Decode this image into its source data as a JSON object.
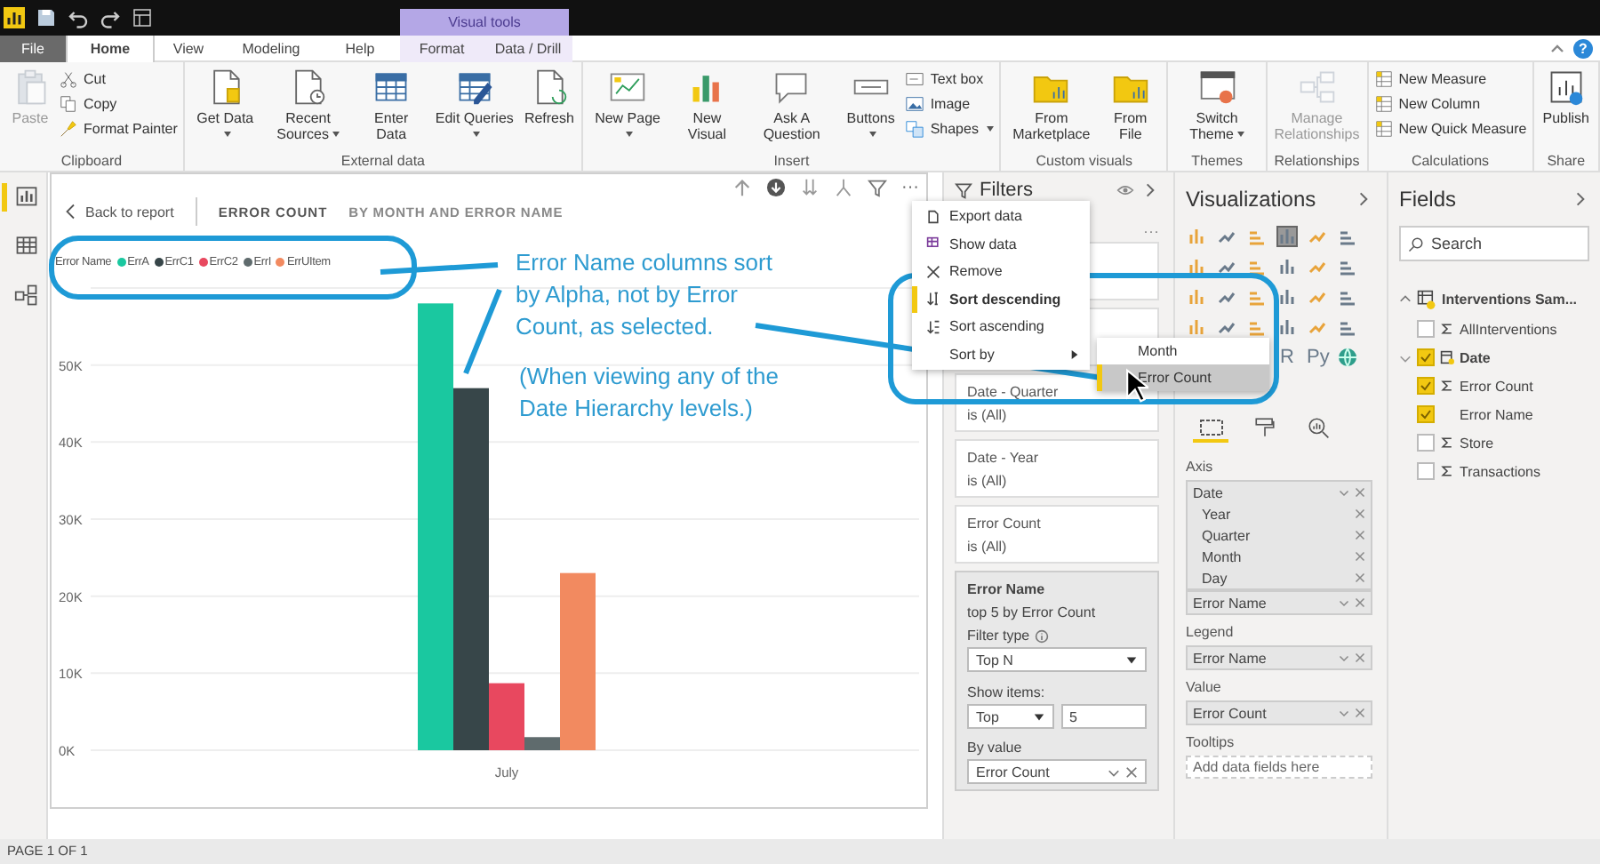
{
  "title_bar": {
    "context_label": "Visual tools"
  },
  "ribbon_tabs": [
    {
      "label": "File",
      "kind": "file",
      "selected": false
    },
    {
      "label": "Home",
      "kind": "normal",
      "selected": true
    },
    {
      "label": "View",
      "kind": "normal",
      "selected": false
    },
    {
      "label": "Modeling",
      "kind": "normal",
      "selected": false
    },
    {
      "label": "Help",
      "kind": "normal",
      "selected": false
    },
    {
      "label": "Format",
      "kind": "context",
      "selected": false
    },
    {
      "label": "Data / Drill",
      "kind": "context",
      "selected": false
    }
  ],
  "help": "?",
  "ribbon_groups": [
    {
      "label": "Clipboard",
      "items": [
        {
          "kind": "large",
          "label": "Paste",
          "disabled": true,
          "dropdown": false
        },
        {
          "kind": "stack",
          "items": [
            {
              "label": "Cut",
              "dropdown": false
            },
            {
              "label": "Copy",
              "dropdown": false
            },
            {
              "label": "Format Painter",
              "dropdown": false
            }
          ]
        }
      ]
    },
    {
      "label": "External data",
      "items": [
        {
          "kind": "large",
          "label": "Get Data",
          "disabled": false,
          "dropdown": true
        },
        {
          "kind": "large",
          "label": "Recent Sources",
          "disabled": false,
          "dropdown": true
        },
        {
          "kind": "large",
          "label": "Enter Data",
          "disabled": false,
          "dropdown": false
        },
        {
          "kind": "large",
          "label": "Edit Queries",
          "disabled": false,
          "dropdown": true
        },
        {
          "kind": "large",
          "label": "Refresh",
          "disabled": false,
          "dropdown": false
        }
      ]
    },
    {
      "label": "Insert",
      "items": [
        {
          "kind": "large",
          "label": "New Page",
          "disabled": false,
          "dropdown": true
        },
        {
          "kind": "large",
          "label": "New Visual",
          "disabled": false,
          "dropdown": false
        },
        {
          "kind": "large",
          "label": "Ask A Question",
          "disabled": false,
          "dropdown": false
        },
        {
          "kind": "large",
          "label": "Buttons",
          "disabled": false,
          "dropdown": true
        },
        {
          "kind": "stack",
          "items": [
            {
              "label": "Text box",
              "dropdown": false
            },
            {
              "label": "Image",
              "dropdown": false
            },
            {
              "label": "Shapes",
              "dropdown": true
            }
          ]
        }
      ]
    },
    {
      "label": "Custom visuals",
      "items": [
        {
          "kind": "large",
          "label": "From Marketplace",
          "disabled": false,
          "dropdown": false
        },
        {
          "kind": "large",
          "label": "From File",
          "disabled": false,
          "dropdown": false
        }
      ]
    },
    {
      "label": "Themes",
      "items": [
        {
          "kind": "large",
          "label": "Switch Theme",
          "disabled": false,
          "dropdown": true
        }
      ]
    },
    {
      "label": "Relationships",
      "items": [
        {
          "kind": "large",
          "label": "Manage Relationships",
          "disabled": true,
          "dropdown": false
        }
      ]
    },
    {
      "label": "Calculations",
      "items": [
        {
          "kind": "stack",
          "items": [
            {
              "label": "New Measure",
              "dropdown": false
            },
            {
              "label": "New Column",
              "dropdown": false
            },
            {
              "label": "New Quick Measure",
              "dropdown": false
            }
          ]
        }
      ]
    },
    {
      "label": "Share",
      "items": [
        {
          "kind": "large",
          "label": "Publish",
          "disabled": false,
          "dropdown": false
        }
      ]
    }
  ],
  "views": [
    {
      "kind": "report",
      "selected": true
    },
    {
      "kind": "data",
      "selected": false
    },
    {
      "kind": "model",
      "selected": false
    }
  ],
  "visual": {
    "more": "···",
    "back": "Back to report",
    "title": "ERROR COUNT",
    "subtitle": "BY MONTH AND ERROR NAME",
    "legend": {
      "title": "Error Name"
    },
    "chart_data": {
      "type": "bar",
      "grid": true,
      "categories": [
        "July"
      ],
      "series": [
        {
          "name": "ErrA",
          "color": "#1ac8a0",
          "values": [
            58000
          ]
        },
        {
          "name": "ErrC1",
          "color": "#374649",
          "values": [
            47000
          ]
        },
        {
          "name": "ErrC2",
          "color": "#e8485f",
          "values": [
            8700
          ]
        },
        {
          "name": "ErrI",
          "color": "#5f6b6d",
          "values": [
            1700
          ]
        },
        {
          "name": "ErrUItem",
          "color": "#f28a60",
          "values": [
            23000
          ]
        }
      ],
      "ylim": [
        0,
        60000
      ],
      "yticks": [
        {
          "value": 0,
          "label": "0K"
        },
        {
          "value": 10000,
          "label": "10K"
        },
        {
          "value": 20000,
          "label": "20K"
        },
        {
          "value": 30000,
          "label": "30K"
        },
        {
          "value": 40000,
          "label": "40K"
        },
        {
          "value": 50000,
          "label": "50K"
        }
      ]
    }
  },
  "annotation": {
    "text": "Error Name columns sort by Alpha, not by Error Count, as selected.",
    "note": "(When viewing any of the Date Hierarchy levels.)"
  },
  "context_menu": {
    "items": [
      {
        "label": "Export data",
        "kind": "export",
        "selected": false
      },
      {
        "label": "Show data",
        "kind": "show",
        "selected": false
      },
      {
        "label": "Remove",
        "kind": "remove",
        "selected": false
      },
      {
        "label": "Sort descending",
        "kind": "sort-desc",
        "selected": true
      },
      {
        "label": "Sort ascending",
        "kind": "sort-asc",
        "selected": false
      },
      {
        "label": "Sort by",
        "kind": "submenu",
        "selected": false
      }
    ],
    "submenu": [
      {
        "label": "Month",
        "selected": false
      },
      {
        "label": "Error Count",
        "selected": true
      }
    ]
  },
  "filters": {
    "title": "Filters",
    "more": "···",
    "cards": [
      {
        "field": "Date - Quarter",
        "state": "is (All)"
      },
      {
        "field": "Date - Year",
        "state": "is (All)"
      },
      {
        "field": "Error Count",
        "state": "is (All)"
      }
    ],
    "active_card": {
      "field": "Error Name",
      "summary": "top 5 by Error Count",
      "filter_type_label": "Filter type",
      "filter_type": "Top N",
      "show_items_label": "Show items:",
      "show_direction": "Top",
      "show_count": "5",
      "by_value_label": "By value",
      "by_value": "Error Count"
    }
  },
  "visualizations": {
    "title": "Visualizations",
    "script_visuals": [
      "R",
      "Py"
    ],
    "pane_tabs": [
      {
        "kind": "fields",
        "selected": true
      },
      {
        "kind": "format",
        "selected": false
      },
      {
        "kind": "analytics",
        "selected": false
      }
    ],
    "wells": [
      {
        "label": "Axis",
        "fields": [
          {
            "label": "Date",
            "children": [
              "Year",
              "Quarter",
              "Month",
              "Day"
            ]
          },
          {
            "label": "Error Name"
          }
        ]
      },
      {
        "label": "Legend",
        "fields": [
          {
            "label": "Error Name"
          }
        ]
      },
      {
        "label": "Value",
        "fields": [
          {
            "label": "Error Count"
          }
        ]
      },
      {
        "label": "Tooltips",
        "placeholder": "Add data fields here"
      }
    ]
  },
  "fields": {
    "title": "Fields",
    "search_placeholder": "Search",
    "tables": [
      {
        "label": "Interventions Sam...",
        "expanded": true,
        "children": [
          {
            "label": "AllInterventions",
            "kind": "measure",
            "checked": false
          },
          {
            "label": "Date",
            "kind": "hierarchy",
            "checked": true,
            "expanded": false
          },
          {
            "label": "Error Count",
            "kind": "measure",
            "checked": true
          },
          {
            "label": "Error Name",
            "kind": "text",
            "checked": true
          },
          {
            "label": "Store",
            "kind": "measure",
            "checked": false
          },
          {
            "label": "Transactions",
            "kind": "measure",
            "checked": false
          }
        ]
      }
    ]
  },
  "status_bar": {
    "page": "PAGE 1 OF 1"
  }
}
